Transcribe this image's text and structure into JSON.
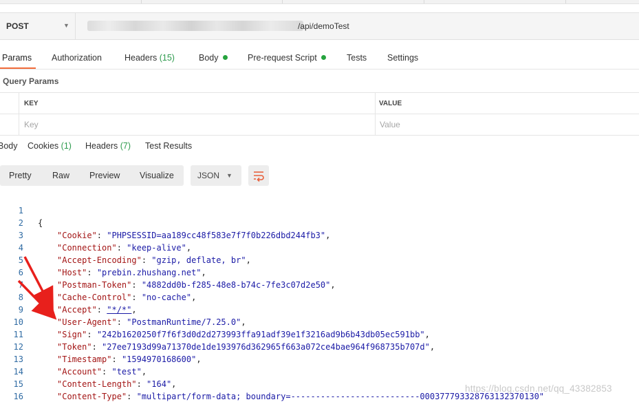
{
  "request": {
    "method": "POST",
    "url_visible": "/api/demoTest"
  },
  "request_tabs": [
    {
      "label": "Params",
      "count": "",
      "dot": false
    },
    {
      "label": "Authorization",
      "count": "",
      "dot": false
    },
    {
      "label": "Headers",
      "count": "(15)",
      "dot": false
    },
    {
      "label": "Body",
      "count": "",
      "dot": true
    },
    {
      "label": "Pre-request Script",
      "count": "",
      "dot": true
    },
    {
      "label": "Tests",
      "count": "",
      "dot": false
    },
    {
      "label": "Settings",
      "count": "",
      "dot": false
    }
  ],
  "query_params": {
    "title": "Query Params",
    "col_key": "KEY",
    "col_value": "VALUE",
    "key_placeholder": "Key",
    "value_placeholder": "Value"
  },
  "response_tabs": [
    {
      "label": "Body",
      "count": ""
    },
    {
      "label": "Cookies",
      "count": "(1)"
    },
    {
      "label": "Headers",
      "count": "(7)"
    },
    {
      "label": "Test Results",
      "count": ""
    }
  ],
  "view_modes": [
    "Pretty",
    "Raw",
    "Preview",
    "Visualize"
  ],
  "format": "JSON",
  "icons": {
    "wrap": "wrap-lines-icon",
    "caret": "chevron-down-icon"
  },
  "colors": {
    "accent": "#f26b3a",
    "green": "#26a33e",
    "arrow": "#e8201c"
  },
  "code": {
    "open_brace": "{",
    "close_brace": "}",
    "line_numbers": [
      "1",
      "2",
      "3",
      "4",
      "5",
      "6",
      "7",
      "8",
      "9",
      "10",
      "11",
      "12",
      "13",
      "14",
      "15",
      "16"
    ],
    "entries": [
      {
        "key": "\"Cookie\"",
        "value": "\"PHPSESSID=aa189cc48f583e7f7f0b226dbd244fb3\"",
        "trail": ","
      },
      {
        "key": "\"Connection\"",
        "value": "\"keep-alive\"",
        "trail": ","
      },
      {
        "key": "\"Accept-Encoding\"",
        "value": "\"gzip, deflate, br\"",
        "trail": ","
      },
      {
        "key": "\"Host\"",
        "value": "\"prebin.zhushang.net\"",
        "trail": ","
      },
      {
        "key": "\"Postman-Token\"",
        "value": "\"4882dd0b-f285-48e8-b74c-7fe3c07d2e50\"",
        "trail": ","
      },
      {
        "key": "\"Cache-Control\"",
        "value": "\"no-cache\"",
        "trail": ","
      },
      {
        "key": "\"Accept\"",
        "value": "\"*/*\"",
        "trail": ","
      },
      {
        "key": "\"User-Agent\"",
        "value": "\"PostmanRuntime/7.25.0\"",
        "trail": ","
      },
      {
        "key": "\"Sign\"",
        "value": "\"242b1620250f7f6f3d0d2d273993ffa91adf39e1f3216ad9b6b43db05ec591bb\"",
        "trail": ","
      },
      {
        "key": "\"Token\"",
        "value": "\"27ee7193d99a71370de1de193976d362965f663a072ce4bae964f968735b707d\"",
        "trail": ","
      },
      {
        "key": "\"Timestamp\"",
        "value": "\"1594970168600\"",
        "trail": ","
      },
      {
        "key": "\"Account\"",
        "value": "\"test\"",
        "trail": ","
      },
      {
        "key": "\"Content-Length\"",
        "value": "\"164\"",
        "trail": ","
      },
      {
        "key": "\"Content-Type\"",
        "value": "\"multipart/form-data; boundary=--------------------------000377793328763132370130\"",
        "trail": ""
      }
    ]
  },
  "watermark": "https://blog.csdn.net/qq_43382853"
}
